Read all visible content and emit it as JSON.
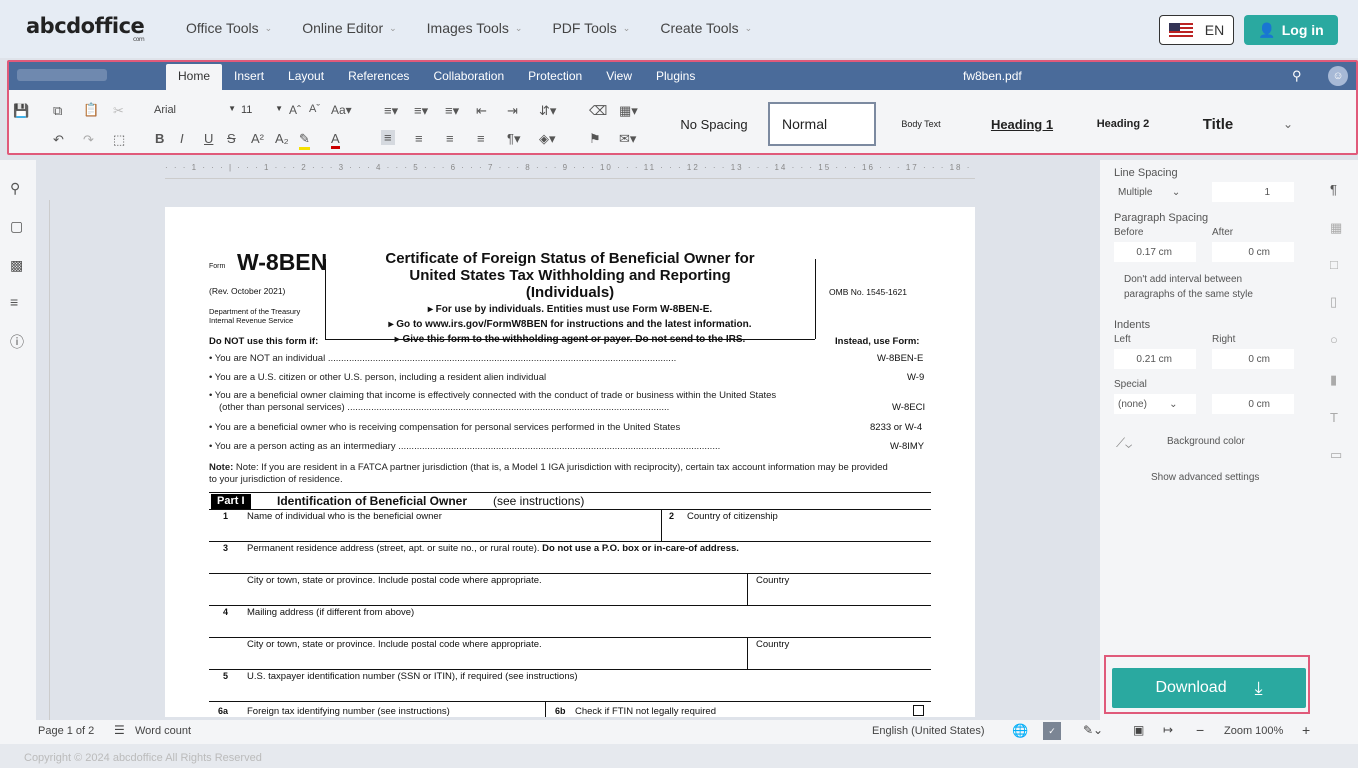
{
  "logo": {
    "name": "abcdoffice",
    "sub": "com"
  },
  "nav": {
    "items": [
      "Office Tools",
      "Online Editor",
      "Images Tools",
      "PDF Tools",
      "Create Tools"
    ]
  },
  "lang": {
    "code": "EN"
  },
  "login": {
    "label": "Log in"
  },
  "menubar": {
    "tabs": [
      "Home",
      "Insert",
      "Layout",
      "References",
      "Collaboration",
      "Protection",
      "View",
      "Plugins"
    ],
    "active_tab": "Home",
    "doc_title": "fw8ben.pdf"
  },
  "toolbar": {
    "font": "Arial",
    "size": "11",
    "styles": [
      "No Spacing",
      "Normal",
      "Body Text",
      "Heading 1",
      "Heading 2",
      "Title"
    ]
  },
  "form": {
    "form_label": "Form",
    "form_number": "W-8BEN",
    "rev": "(Rev. October 2021)",
    "dept1": "Department of the Treasury",
    "dept2": "Internal Revenue Service",
    "title1": "Certificate of Foreign Status of Beneficial Owner for",
    "title2": "United States Tax Withholding and Reporting",
    "title3": "(Individuals)",
    "bullet1": "▸ For use by individuals. Entities must use Form W-8BEN-E.",
    "bullet2": "▸ Go to www.irs.gov/FormW8BEN for instructions and the latest information.",
    "bullet3": "▸ Give this form to the withholding agent or payer. Do not send to the IRS.",
    "omb": "OMB No. 1545-1621",
    "do_not": "Do NOT use this form if:",
    "instead": "Instead, use Form:",
    "lines": [
      {
        "text": "You are NOT an individual",
        "form": "W-8BEN-E"
      },
      {
        "text": "You are a U.S. citizen or other U.S. person, including a resident alien individual",
        "form": "W-9"
      },
      {
        "text": "You are a beneficial owner claiming that income is effectively connected with the conduct of trade or business within the United States",
        "text2": "(other than personal services)",
        "form": "W-8ECI"
      },
      {
        "text": "You are a beneficial owner who is receiving compensation for personal services performed in the United States",
        "form": "8233 or W-4"
      },
      {
        "text": "You are a person acting as an intermediary",
        "form": "W-8IMY"
      }
    ],
    "note1": "Note: If you are resident in a FATCA partner jurisdiction (that is, a Model 1 IGA jurisdiction with reciprocity), certain tax account information may be provided",
    "note2": "to your jurisdiction of residence.",
    "part": "Part I",
    "part_title": "Identification of Beneficial Owner",
    "part_sub": "(see instructions)",
    "f1n": "1",
    "f1": "Name of individual who is the beneficial owner",
    "f2n": "2",
    "f2": "Country of citizenship",
    "f3n": "3",
    "f3": "Permanent residence address (street, apt. or suite no., or rural route).",
    "f3b": "Do not use a P.O. box or in-care-of address.",
    "city": "City or town, state or province. Include postal code where appropriate.",
    "country": "Country",
    "f4n": "4",
    "f4": "Mailing address (if different from above)",
    "city2": "City or town, state or province. Include postal code where appropriate.",
    "country2": "Country",
    "f5n": "5",
    "f5": "U.S. taxpayer identification number (SSN or ITIN), if required (see instructions)",
    "f6an": "6a",
    "f6a": "Foreign tax identifying number (see instructions)",
    "f6bn": "6b",
    "f6b": "Check if FTIN not legally required"
  },
  "panel": {
    "line_spacing": "Line Spacing",
    "ls_mode": "Multiple",
    "ls_value": "1",
    "para_spacing": "Paragraph Spacing",
    "before": "Before",
    "after": "After",
    "before_val": "0.17 cm",
    "after_val": "0 cm",
    "dont_add1": "Don't add interval between",
    "dont_add2": "paragraphs of the same style",
    "indents": "Indents",
    "left": "Left",
    "right": "Right",
    "left_val": "0.21 cm",
    "right_val": "0 cm",
    "special": "Special",
    "special_mode": "(none)",
    "special_val": "0 cm",
    "bg_color": "Background color",
    "advanced": "Show advanced settings"
  },
  "download": {
    "label": "Download"
  },
  "status": {
    "page": "Page 1 of 2",
    "word_count": "Word count",
    "language": "English (United States)",
    "zoom": "Zoom 100%"
  },
  "footer": {
    "text": "Copyright © 2024 abcdoffice All Rights Reserved"
  }
}
